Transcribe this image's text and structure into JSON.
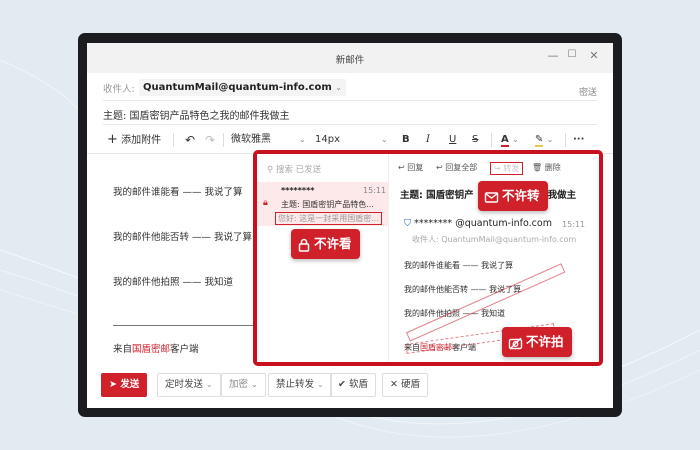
{
  "window": {
    "title": "新邮件"
  },
  "compose": {
    "to_label": "收件人:",
    "to_value": "QuantumMail@quantum-info.com",
    "bcc": "密送",
    "subject": "主题:  国盾密钥产品特色之我的邮件我做主"
  },
  "toolbar": {
    "attach": "添加附件",
    "font": "微软雅黑",
    "size": "14px",
    "bold": "B",
    "italic": "I",
    "underline": "U",
    "strike": "S",
    "more": "···"
  },
  "body": {
    "line1": "我的邮件谁能看 —— 我说了算",
    "line2": "我的邮件他能否转 —— 我说了算",
    "line3": "我的邮件他拍照 —— 我知道",
    "from_prefix": "来自",
    "from_brand": "国盾密邮",
    "from_suffix": "客户端"
  },
  "bottom": {
    "send": "发送",
    "scheduled": "定时发送",
    "encrypt": "加密",
    "noforward": "禁止转发",
    "soft_shield": "软盾",
    "hard_shield": "硬盾"
  },
  "preview": {
    "search": "搜索 已发送",
    "msg_sender": "********",
    "msg_time": "15:11",
    "msg_subject": "主题:  国盾密钥产品特色...",
    "msg_snippet": "您好:  这是一封采用国盾密...",
    "actions": {
      "reply": "回复",
      "reply_all": "回复全部",
      "forward": "转发",
      "delete": "删除"
    },
    "subject": "主题:  国盾密钥产",
    "subject_tail": "我做主",
    "sender": "******** @quantum-info.com",
    "time": "15:11",
    "recipient": "收件人: QuantumMail@quantum-info.com",
    "line1": "我的邮件谁能看 —— 我说了算",
    "line2": "我的邮件他能否转 —— 我说了算",
    "line3": "我的邮件他拍照 —— 我知道",
    "from_prefix": "来自",
    "from_brand": "国盾密邮",
    "from_suffix": "客户端"
  },
  "badges": {
    "no_view": "不许看",
    "no_forward": "不许转",
    "no_photo": "不许拍"
  },
  "colors": {
    "accent": "#d0202a",
    "frame": "#c8101e",
    "highlight": "#fde8ea"
  }
}
